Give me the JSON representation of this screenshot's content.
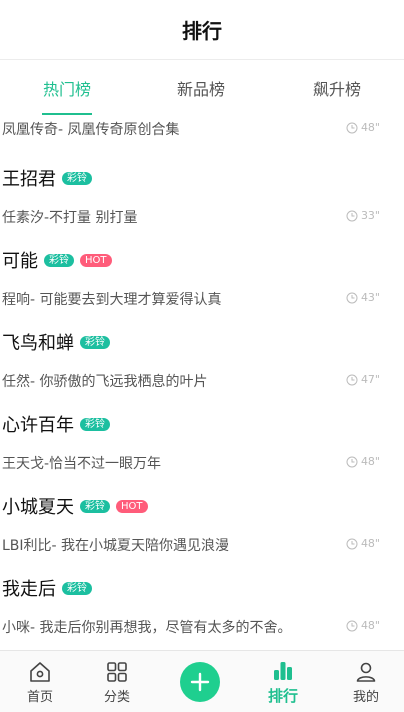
{
  "header": {
    "title": "排行"
  },
  "tabs": [
    {
      "label": "热门榜"
    },
    {
      "label": "新品榜"
    },
    {
      "label": "飙升榜"
    }
  ],
  "songs": [
    {
      "name": "",
      "subtitle": "凤凰传奇-  凤凰传奇原创合集",
      "duration": "48\""
    },
    {
      "name": "王招君",
      "badges": [
        "彩铃"
      ],
      "subtitle": "任素汐-不打量 别打量",
      "duration": "33\""
    },
    {
      "name": "可能",
      "badges": [
        "彩铃",
        "HOT"
      ],
      "subtitle": "程响- 可能要去到大理才算爱得认真",
      "duration": "43\""
    },
    {
      "name": "飞鸟和蝉",
      "badges": [
        "彩铃"
      ],
      "subtitle": "任然- 你骄傲的飞远我栖息的叶片",
      "duration": "47\""
    },
    {
      "name": "心许百年",
      "badges": [
        "彩铃"
      ],
      "subtitle": "王天戈-恰当不过一眼万年",
      "duration": "48\""
    },
    {
      "name": "小城夏天",
      "badges": [
        "彩铃",
        "HOT"
      ],
      "subtitle": "LBI利比- 我在小城夏天陪你遇见浪漫",
      "duration": "48\""
    },
    {
      "name": "我走后",
      "badges": [
        "彩铃"
      ],
      "subtitle": "小咪- 我走后你别再想我，尽管有太多的不舍。",
      "duration": "48\""
    }
  ],
  "bottom_nav": [
    {
      "label": "首页",
      "icon": "home-icon"
    },
    {
      "label": "分类",
      "icon": "grid-icon"
    },
    {
      "label": "",
      "icon": "plus-icon"
    },
    {
      "label": "排行",
      "icon": "rank-bars-icon"
    },
    {
      "label": "我的",
      "icon": "user-icon"
    }
  ],
  "colors": {
    "accent": "#1fbf8f",
    "cailing": "#1cbfa0",
    "hot": "#ff5c7a"
  }
}
